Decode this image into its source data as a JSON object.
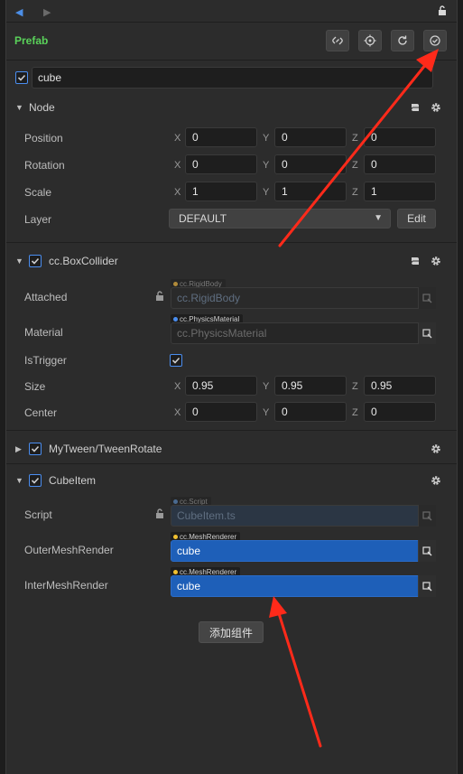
{
  "header": {
    "prefab_label": "Prefab"
  },
  "node": {
    "name": "cube",
    "active": true
  },
  "sections": {
    "node": {
      "title": "Node",
      "position": {
        "label": "Position",
        "x": "0",
        "y": "0",
        "z": "0"
      },
      "rotation": {
        "label": "Rotation",
        "x": "0",
        "y": "0",
        "z": "0"
      },
      "scale": {
        "label": "Scale",
        "x": "1",
        "y": "1",
        "z": "1"
      },
      "layer": {
        "label": "Layer",
        "value": "DEFAULT",
        "edit_label": "Edit"
      }
    },
    "box_collider": {
      "title": "cc.BoxCollider",
      "attached": {
        "label": "Attached",
        "tag": "cc.RigidBody",
        "value": "cc.RigidBody"
      },
      "material": {
        "label": "Material",
        "tag": "cc.PhysicsMaterial",
        "value": "cc.PhysicsMaterial"
      },
      "is_trigger": {
        "label": "IsTrigger",
        "checked": true
      },
      "size": {
        "label": "Size",
        "x": "0.95",
        "y": "0.95",
        "z": "0.95"
      },
      "center": {
        "label": "Center",
        "x": "0",
        "y": "0",
        "z": "0"
      }
    },
    "tween": {
      "title": "MyTween/TweenRotate"
    },
    "cube_item": {
      "title": "CubeItem",
      "script": {
        "label": "Script",
        "tag": "cc.Script",
        "value": "CubeItem.ts"
      },
      "outer": {
        "label": "OuterMeshRender",
        "tag": "cc.MeshRenderer",
        "value": "cube"
      },
      "inter": {
        "label": "InterMeshRender",
        "tag": "cc.MeshRenderer",
        "value": "cube"
      }
    }
  },
  "axes": {
    "x": "X",
    "y": "Y",
    "z": "Z"
  },
  "add_component_label": "添加组件",
  "colors": {
    "accent": "#4a8ef0",
    "prefab_green": "#5ad25a",
    "field_blue": "#1e5fb8",
    "annotation_red": "#ff2a1a"
  }
}
